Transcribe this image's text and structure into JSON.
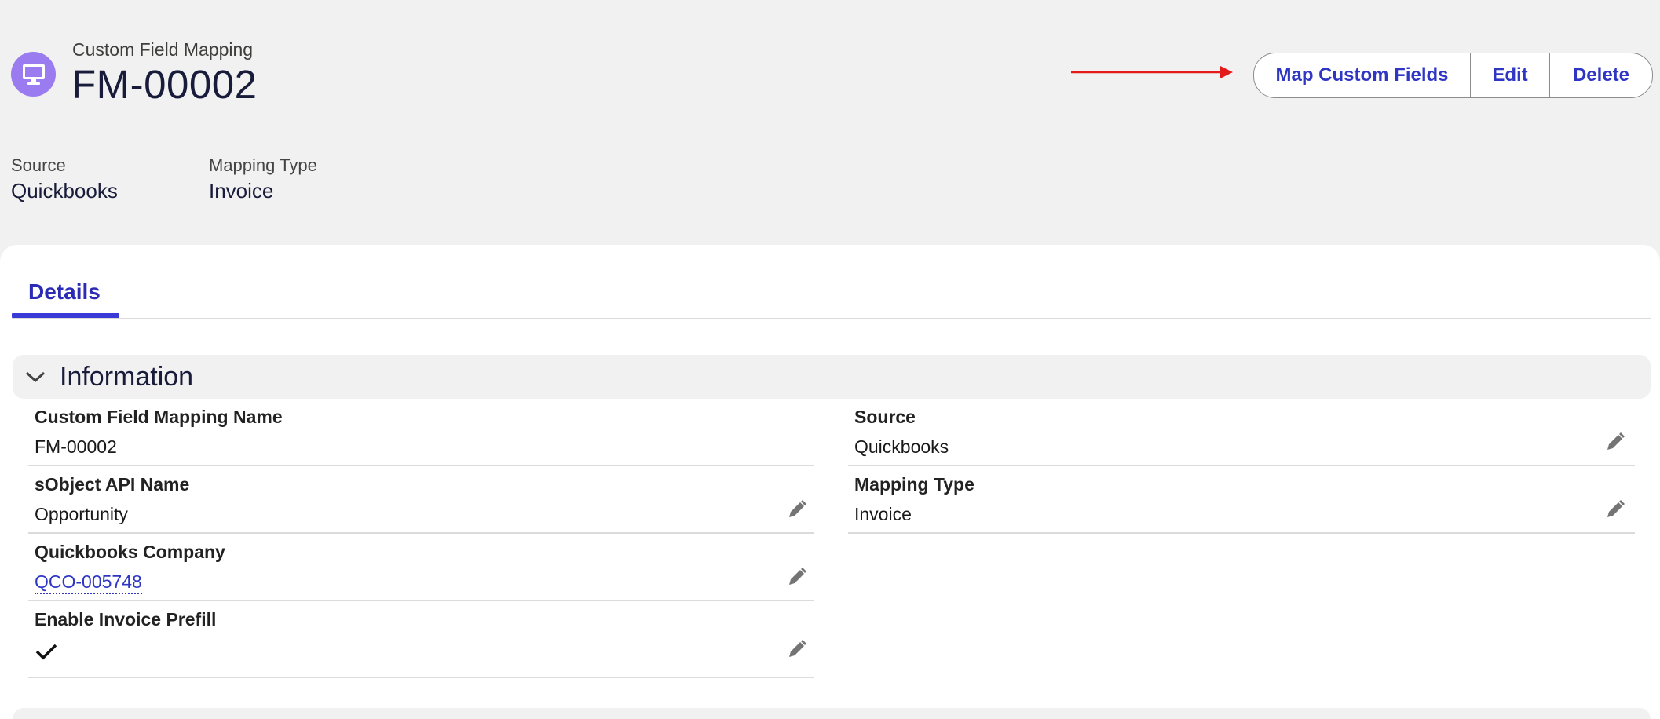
{
  "header": {
    "object_label": "Custom Field Mapping",
    "record_name": "FM-00002",
    "icon": "desktop-icon",
    "icon_color": "#9a7bf0"
  },
  "actions": {
    "map_custom_fields": "Map Custom Fields",
    "edit": "Edit",
    "delete": "Delete",
    "color": "#2f36c4"
  },
  "annotation": {
    "arrow_color": "#e31b1b"
  },
  "highlights": {
    "source_label": "Source",
    "source_value": "Quickbooks",
    "mapping_type_label": "Mapping Type",
    "mapping_type_value": "Invoice"
  },
  "tabs": {
    "details": "Details"
  },
  "section": {
    "title": "Information"
  },
  "fields": {
    "name_label": "Custom Field Mapping Name",
    "name_value": "FM-00002",
    "sobject_label": "sObject API Name",
    "sobject_value": "Opportunity",
    "company_label": "Quickbooks Company",
    "company_value": "QCO-005748",
    "prefill_label": "Enable Invoice Prefill",
    "prefill_checked": true,
    "source_label": "Source",
    "source_value": "Quickbooks",
    "mapping_type_label": "Mapping Type",
    "mapping_type_value": "Invoice"
  }
}
